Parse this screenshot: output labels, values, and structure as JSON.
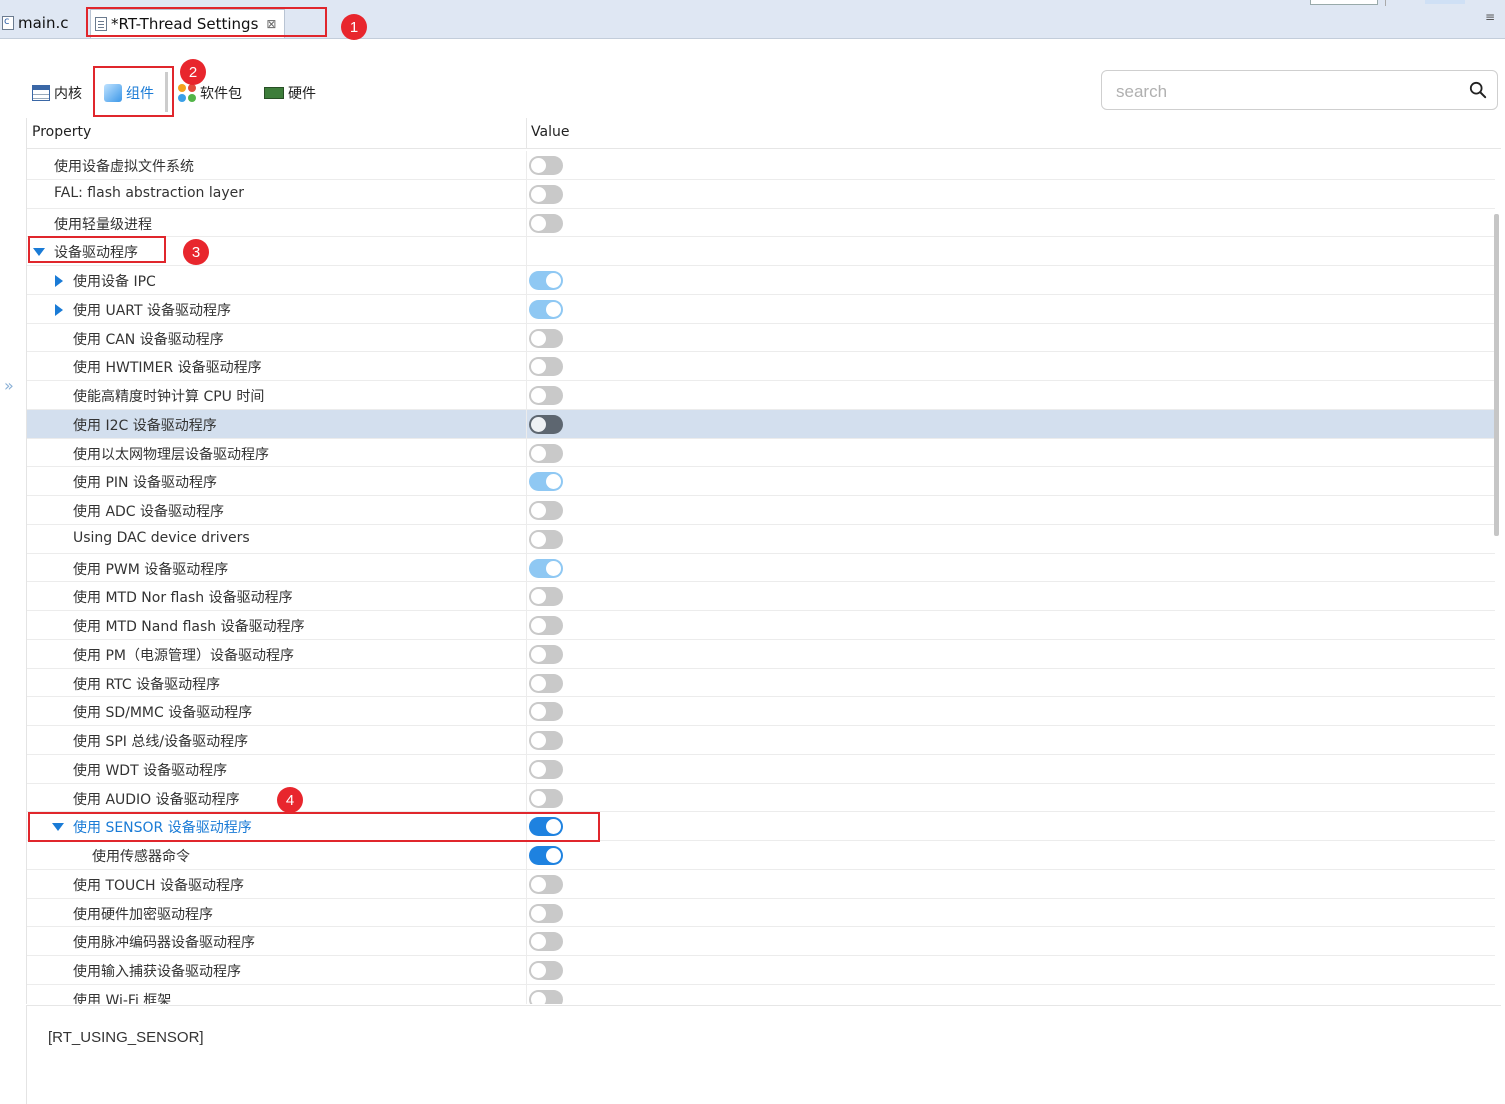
{
  "editor_tabs": [
    {
      "label": "main.c"
    },
    {
      "label": "*RT-Thread Settings",
      "close": "⊠"
    }
  ],
  "view_menu": "≡",
  "component_tabs": [
    {
      "label": "内核"
    },
    {
      "label": "组件"
    },
    {
      "label": "软件包"
    },
    {
      "label": "硬件"
    }
  ],
  "search": {
    "placeholder": "search",
    "value": ""
  },
  "table": {
    "headers": {
      "property": "Property",
      "value": "Value"
    },
    "rows": [
      {
        "label": "使用设备虚拟文件系统",
        "state": "off"
      },
      {
        "label": "FAL: flash abstraction layer",
        "state": "off"
      },
      {
        "label": "使用轻量级进程",
        "state": "off"
      },
      {
        "label": "设备驱动程序",
        "state": "none",
        "expander": "down"
      },
      {
        "label": "使用设备 IPC",
        "state": "on-light",
        "expander": "right"
      },
      {
        "label": "使用 UART 设备驱动程序",
        "state": "on-light",
        "expander": "right"
      },
      {
        "label": "使用 CAN 设备驱动程序",
        "state": "off"
      },
      {
        "label": "使用 HWTIMER 设备驱动程序",
        "state": "off"
      },
      {
        "label": "使能高精度时钟计算 CPU 时间",
        "state": "off"
      },
      {
        "label": "使用 I2C 设备驱动程序",
        "state": "off-dark",
        "selected": true
      },
      {
        "label": "使用以太网物理层设备驱动程序",
        "state": "off"
      },
      {
        "label": "使用 PIN 设备驱动程序",
        "state": "on-light"
      },
      {
        "label": "使用 ADC 设备驱动程序",
        "state": "off"
      },
      {
        "label": "Using DAC device drivers",
        "state": "off"
      },
      {
        "label": "使用 PWM 设备驱动程序",
        "state": "on-light"
      },
      {
        "label": "使用 MTD Nor flash 设备驱动程序",
        "state": "off"
      },
      {
        "label": "使用 MTD Nand flash 设备驱动程序",
        "state": "off"
      },
      {
        "label": "使用 PM（电源管理）设备驱动程序",
        "state": "off"
      },
      {
        "label": "使用 RTC 设备驱动程序",
        "state": "off"
      },
      {
        "label": "使用 SD/MMC 设备驱动程序",
        "state": "off"
      },
      {
        "label": "使用 SPI 总线/设备驱动程序",
        "state": "off"
      },
      {
        "label": "使用 WDT 设备驱动程序",
        "state": "off"
      },
      {
        "label": "使用 AUDIO 设备驱动程序",
        "state": "off"
      },
      {
        "label": "使用 SENSOR 设备驱动程序",
        "state": "on",
        "expander": "down",
        "highlight": true
      },
      {
        "label": "使用传感器命令",
        "state": "on"
      },
      {
        "label": "使用 TOUCH 设备驱动程序",
        "state": "off"
      },
      {
        "label": "使用硬件加密驱动程序",
        "state": "off"
      },
      {
        "label": "使用脉冲编码器设备驱动程序",
        "state": "off"
      },
      {
        "label": "使用输入捕获设备驱动程序",
        "state": "off"
      },
      {
        "label": "使用 Wi-Fi 框架",
        "state": "off"
      }
    ]
  },
  "detail": {
    "macro": "[RT_USING_SENSOR]"
  },
  "annotations": [
    "1",
    "2",
    "3",
    "4"
  ],
  "colors": {
    "accent": "#1a7bd6",
    "annotation": "#e0262c",
    "selected_row": "#d3dfee"
  }
}
